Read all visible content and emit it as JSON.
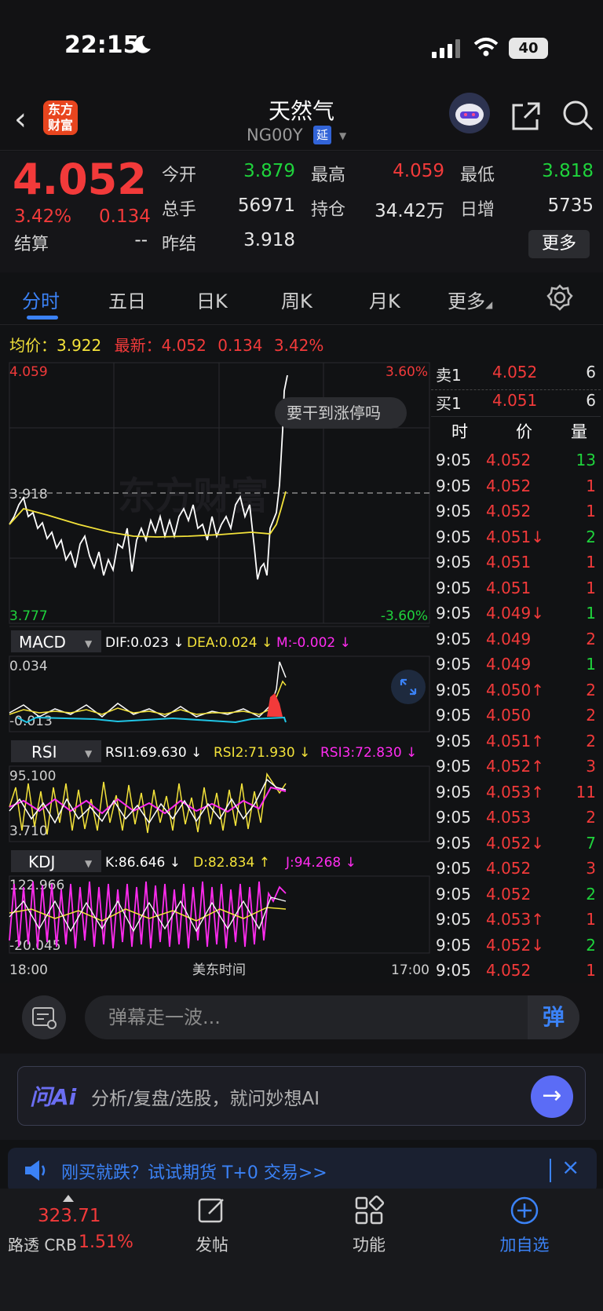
{
  "status": {
    "time": "22:15",
    "battery": "40"
  },
  "nav": {
    "title": "天然气",
    "code": "NG00Y",
    "delay_badge": "延",
    "logo_line1": "东方",
    "logo_line2": "财富"
  },
  "quote": {
    "price": "4.052",
    "pct": "3.42%",
    "change": "0.134",
    "rows": [
      [
        {
          "label": "今开",
          "value": "3.879",
          "color": "#1fd33c"
        },
        {
          "label": "最高",
          "value": "4.059",
          "color": "#f23a3a"
        },
        {
          "label": "最低",
          "value": "3.818",
          "color": "#1fd33c"
        }
      ],
      [
        {
          "label": "总手",
          "value": "56971",
          "color": "#e6e6e6"
        },
        {
          "label": "持仓",
          "value": "34.42万",
          "color": "#e6e6e6"
        },
        {
          "label": "日增",
          "value": "5735",
          "color": "#e6e6e6"
        }
      ]
    ],
    "settle_label": "结算",
    "settle_value": "--",
    "prev_label": "昨结",
    "prev_value": "3.918",
    "more": "更多"
  },
  "tabs": [
    "分时",
    "五日",
    "日K",
    "周K",
    "月K",
    "更多"
  ],
  "avg": {
    "avg_label": "均价：",
    "avg_value": "3.922",
    "last_label": "最新：",
    "last_value": "4.052",
    "change": "0.134",
    "pct": "3.42%"
  },
  "main_chart": {
    "y_high": "4.059",
    "y_mid": "3.918",
    "y_low": "3.777",
    "pct_high": "3.60%",
    "pct_low": "-3.60%",
    "watermark": "东方财富",
    "bubble": "要干到涨停吗",
    "x_start": "18:00",
    "x_mid": "美东时间",
    "x_end": "17:00"
  },
  "macd": {
    "name": "MACD",
    "dif": "DIF:0.023 ↓",
    "dea": "DEA:0.024 ↓",
    "m": "M:-0.002 ↓",
    "top": "0.034",
    "bottom": "-0.013"
  },
  "rsi": {
    "name": "RSI",
    "r1": "RSI1:69.630 ↓",
    "r2": "RSI2:71.930 ↓",
    "r3": "RSI3:72.830 ↓",
    "top": "95.100",
    "bottom": "3.710"
  },
  "kdj": {
    "name": "KDJ",
    "k": "K:86.646 ↓",
    "d": "D:82.834 ↑",
    "j": "J:94.268 ↓",
    "top": "122.966",
    "bottom": "-20.045"
  },
  "orderbook": {
    "sell": {
      "label": "卖1",
      "price": "4.052",
      "vol": "6"
    },
    "buy": {
      "label": "买1",
      "price": "4.051",
      "vol": "6"
    }
  },
  "trades_header": [
    "时",
    "价",
    "量"
  ],
  "trades": [
    {
      "t": "9:05",
      "p": "4.052",
      "v": "13",
      "vc": "#1fd33c"
    },
    {
      "t": "9:05",
      "p": "4.052",
      "v": "1",
      "vc": "#f23a3a"
    },
    {
      "t": "9:05",
      "p": "4.052",
      "v": "1",
      "vc": "#f23a3a"
    },
    {
      "t": "9:05",
      "p": "4.051↓",
      "v": "2",
      "vc": "#1fd33c"
    },
    {
      "t": "9:05",
      "p": "4.051",
      "v": "1",
      "vc": "#f23a3a"
    },
    {
      "t": "9:05",
      "p": "4.051",
      "v": "1",
      "vc": "#f23a3a"
    },
    {
      "t": "9:05",
      "p": "4.049↓",
      "v": "1",
      "vc": "#1fd33c"
    },
    {
      "t": "9:05",
      "p": "4.049",
      "v": "2",
      "vc": "#f23a3a"
    },
    {
      "t": "9:05",
      "p": "4.049",
      "v": "1",
      "vc": "#1fd33c"
    },
    {
      "t": "9:05",
      "p": "4.050↑",
      "v": "2",
      "vc": "#f23a3a"
    },
    {
      "t": "9:05",
      "p": "4.050",
      "v": "2",
      "vc": "#f23a3a"
    },
    {
      "t": "9:05",
      "p": "4.051↑",
      "v": "2",
      "vc": "#f23a3a"
    },
    {
      "t": "9:05",
      "p": "4.052↑",
      "v": "3",
      "vc": "#f23a3a"
    },
    {
      "t": "9:05",
      "p": "4.053↑",
      "v": "11",
      "vc": "#f23a3a"
    },
    {
      "t": "9:05",
      "p": "4.053",
      "v": "2",
      "vc": "#f23a3a"
    },
    {
      "t": "9:05",
      "p": "4.052↓",
      "v": "7",
      "vc": "#1fd33c"
    },
    {
      "t": "9:05",
      "p": "4.052",
      "v": "3",
      "vc": "#f23a3a"
    },
    {
      "t": "9:05",
      "p": "4.052",
      "v": "2",
      "vc": "#1fd33c"
    },
    {
      "t": "9:05",
      "p": "4.053↑",
      "v": "1",
      "vc": "#f23a3a"
    },
    {
      "t": "9:05",
      "p": "4.052↓",
      "v": "2",
      "vc": "#1fd33c"
    },
    {
      "t": "9:05",
      "p": "4.052",
      "v": "1",
      "vc": "#f23a3a"
    }
  ],
  "comment": {
    "placeholder": "弹幕走一波...",
    "dan": "弹"
  },
  "ai": {
    "brand": "问Ai",
    "placeholder": "分析/复盘/选股，就问妙想AI"
  },
  "promo": {
    "text": "刚买就跌？试试期货 T+0 交易>>"
  },
  "bottom": {
    "index_value": "323.71",
    "index_name": "路透 CRB",
    "index_pct": "1.51%",
    "post": "发帖",
    "func": "功能",
    "add": "加自选"
  },
  "colors": {
    "red": "#f23a3a",
    "green": "#1fd33c",
    "yellow": "#f3e23a",
    "magenta": "#ff2cf0",
    "blue": "#3b82f6"
  }
}
